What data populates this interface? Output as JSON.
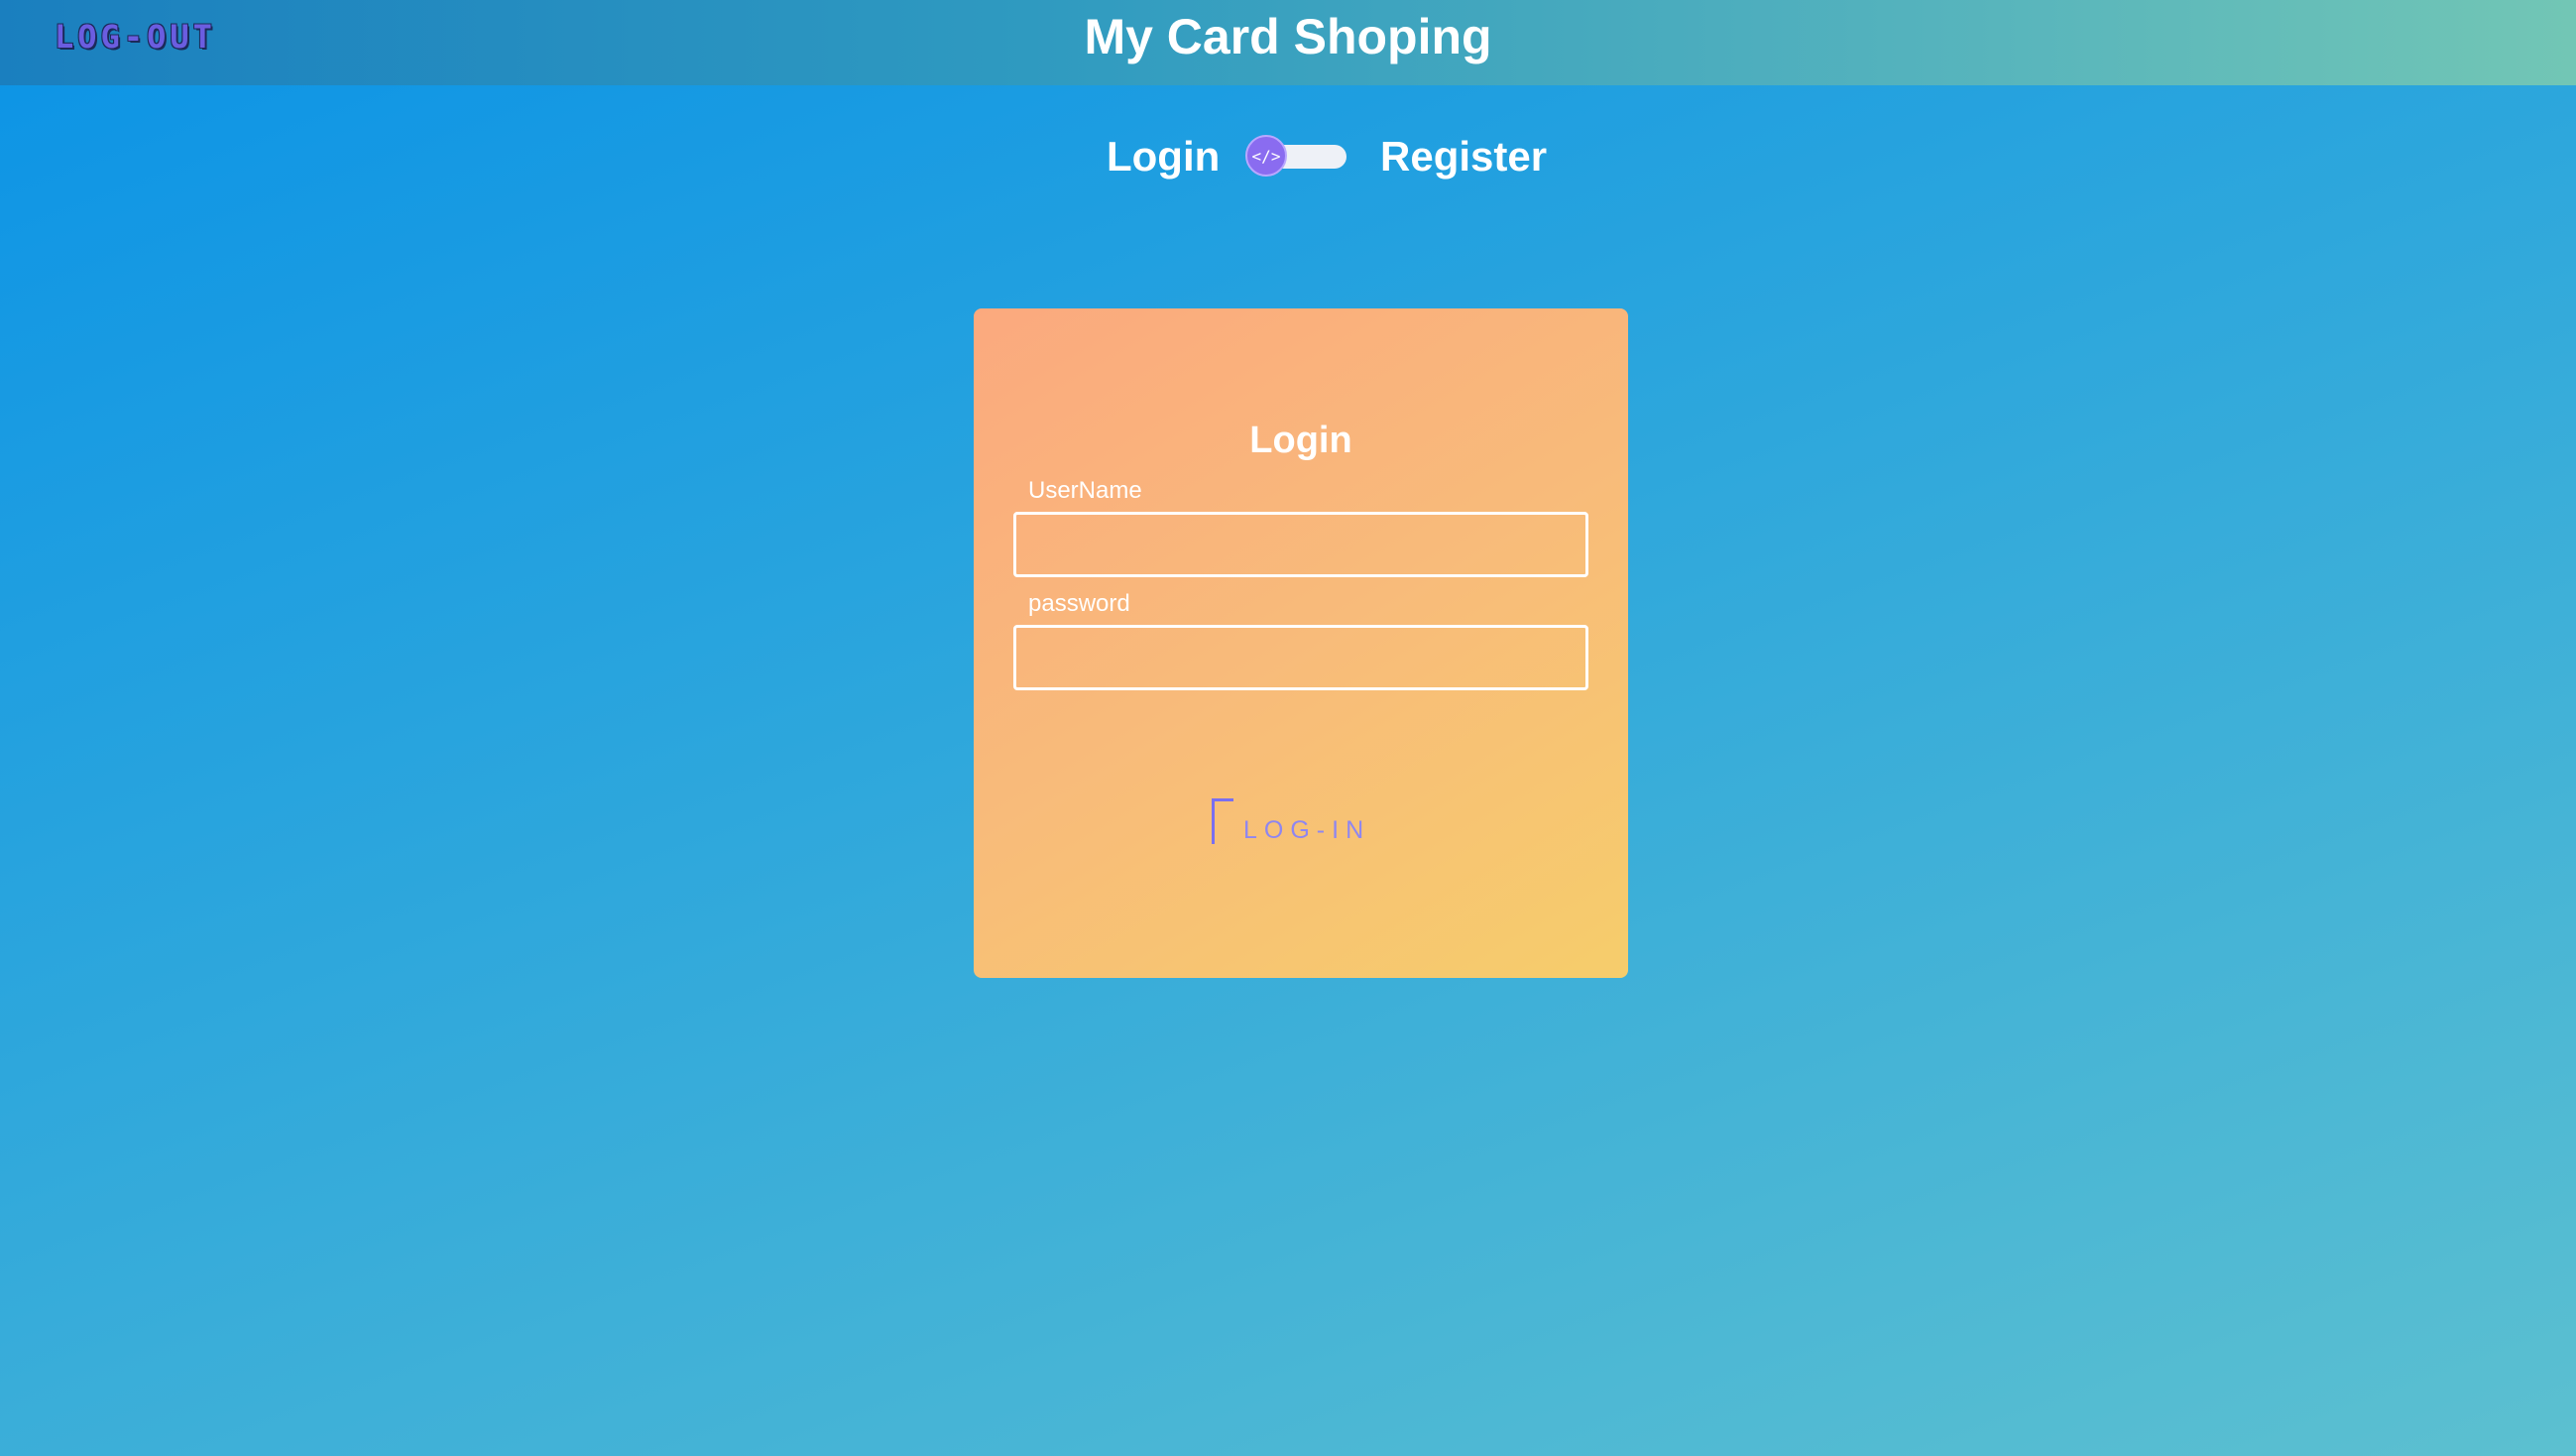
{
  "header": {
    "logout_label": "LOG-OUT",
    "app_title": "My Card Shoping"
  },
  "mode_switch": {
    "login_label": "Login",
    "register_label": "Register",
    "knob_icon": "code-icon",
    "knob_glyph": "</>",
    "selected": "Login"
  },
  "login_form": {
    "title": "Login",
    "username_label": "UserName",
    "username_value": "",
    "password_label": "password",
    "password_value": "",
    "submit_label": "LOG-IN"
  },
  "colors": {
    "background_start": "#0b93e6",
    "background_end": "#5cc0d0",
    "card_start": "#fba97e",
    "card_end": "#f6cd6b",
    "accent": "#8a6cf0",
    "text": "#ffffff"
  }
}
